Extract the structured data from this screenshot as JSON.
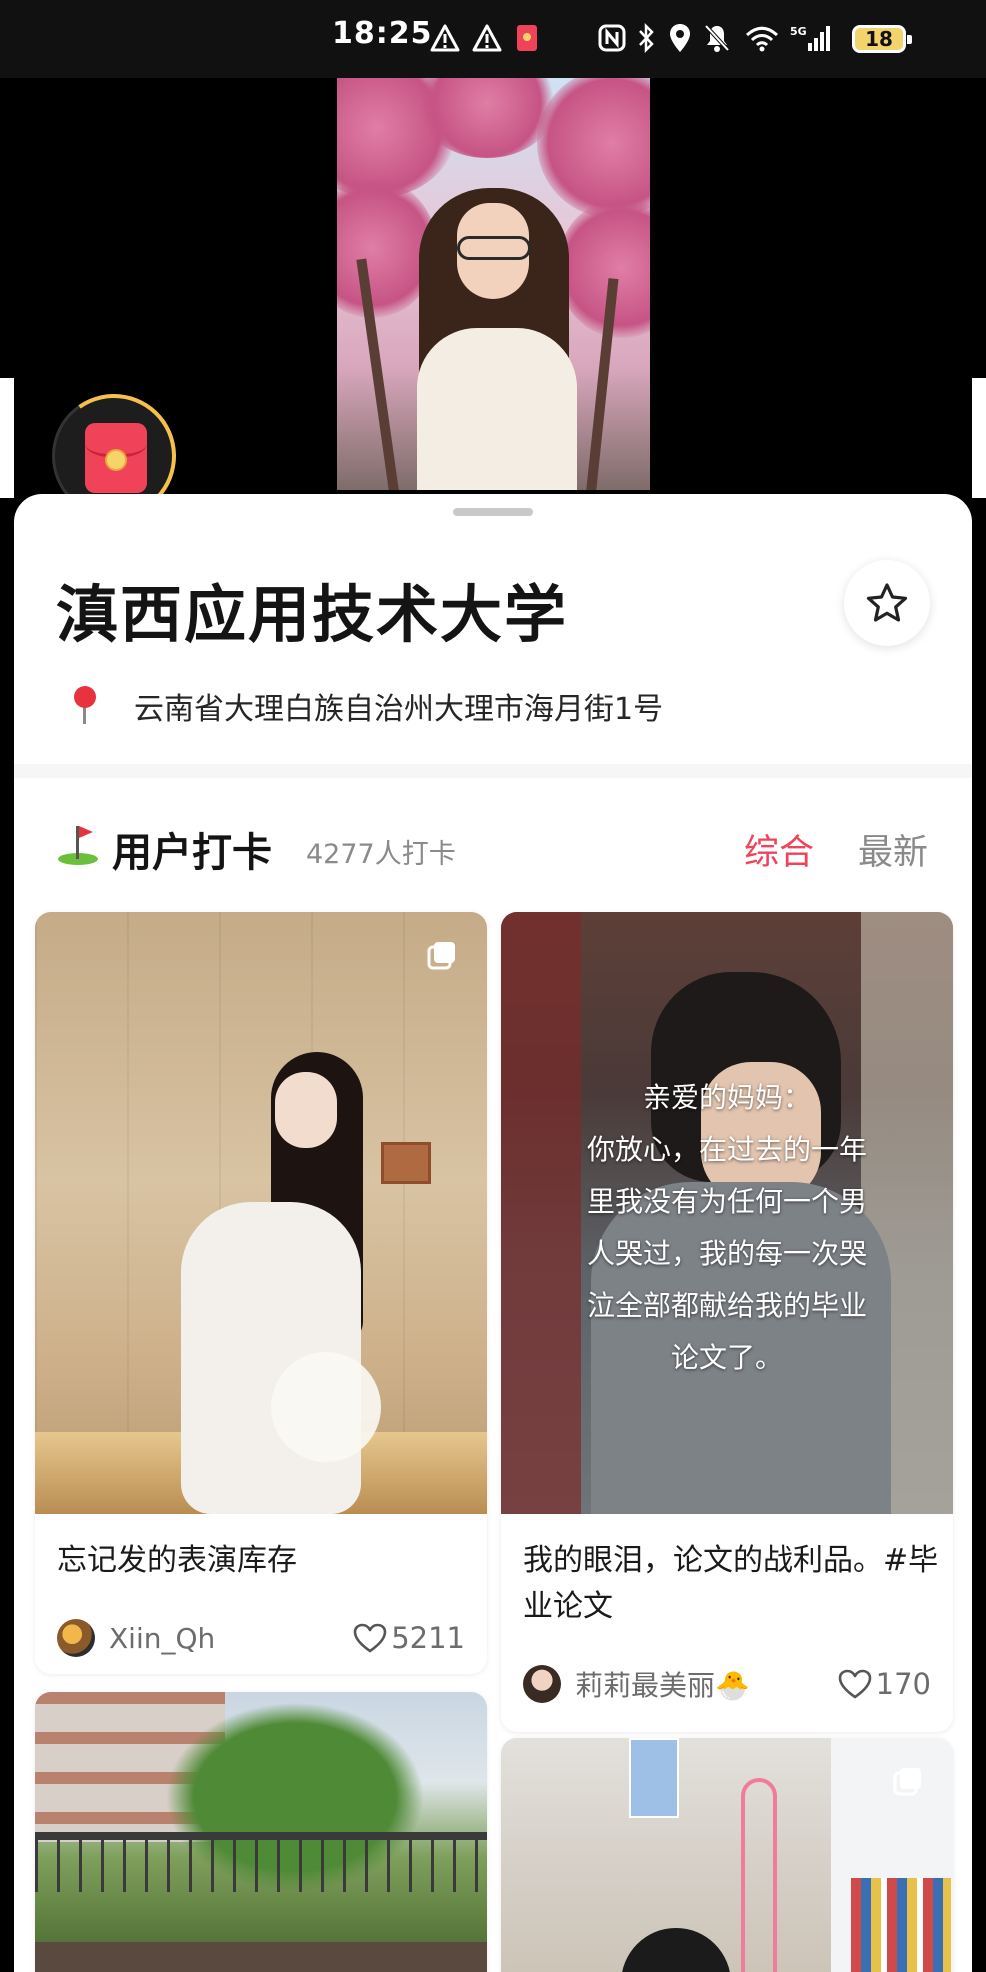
{
  "status_bar": {
    "time": "18:25",
    "battery": "18"
  },
  "place": {
    "name": "滇西应用技术大学",
    "address": "云南省大理白族自治州大理市海月街1号"
  },
  "checkins": {
    "title": "用户打卡",
    "count": "4277人打卡",
    "tabs": [
      {
        "label": "综合",
        "active": true
      },
      {
        "label": "最新",
        "active": false
      }
    ]
  },
  "posts": [
    {
      "title": "忘记发的表演库存",
      "author": "Xiin_Qh",
      "likes": "5211"
    },
    {
      "title": "我的眼泪，论文的战利品。#毕业论文",
      "author": "莉莉最美丽🐣",
      "likes": "170",
      "overlay_lines": [
        "亲爱的妈妈：",
        "你放心，在过去的一年",
        "里我没有为任何一个男",
        "人哭过，我的每一次哭",
        "泣全部都献给我的毕业",
        "论文了。"
      ]
    }
  ],
  "colors": {
    "accent": "#f0435a",
    "muted": "#8a8a8a"
  }
}
